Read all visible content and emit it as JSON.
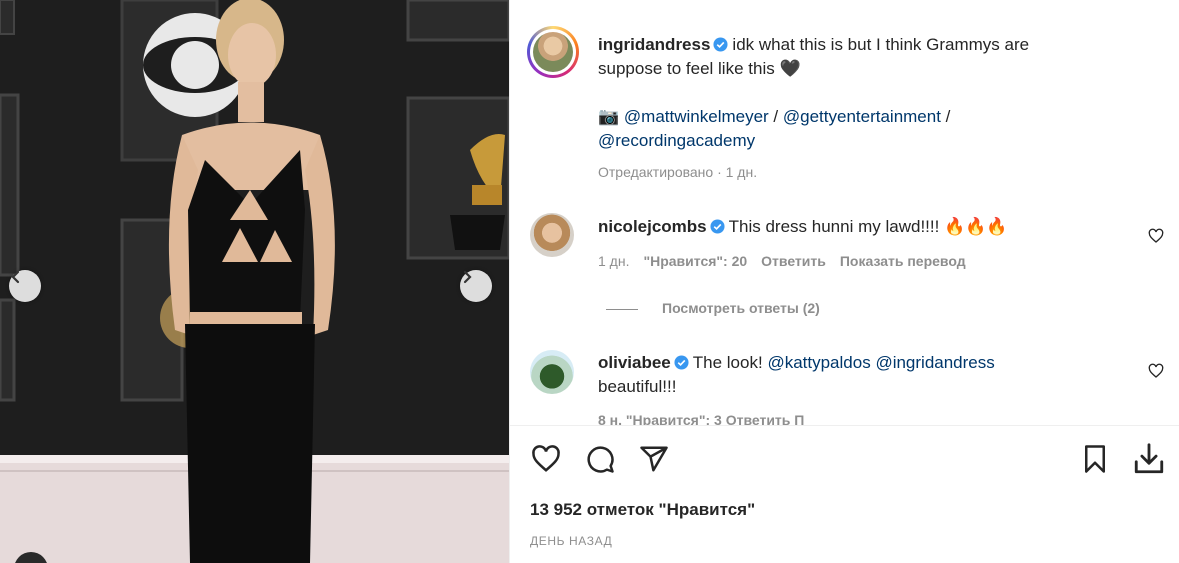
{
  "post": {
    "author": "ingridandress",
    "caption_line1": "idk what this is but I think Grammys are",
    "caption_line2": "suppose to feel like this 🖤",
    "camera_emoji": "📷",
    "credit1": "@mattwinkelmeyer",
    "sep1": " / ",
    "credit2": "@gettyentertainment",
    "sep2": " /",
    "credit3": "@recordingacademy",
    "edited": "Отредактировано · 1 дн."
  },
  "comments": [
    {
      "user": "nicolejcombs",
      "text": "This dress hunni my lawd!!!! 🔥🔥🔥",
      "time": "1 дн.",
      "likes": "\"Нравится\": 20",
      "reply": "Ответить",
      "translate": "Показать перевод",
      "view_replies": "Посмотреть ответы (2)"
    },
    {
      "user": "oliviabee",
      "text": "The look!",
      "mention1": "@kattypaldos",
      "mention2": "@ingridandress",
      "text2": "beautiful!!!",
      "meta_partial": "8 н.   \"Нравится\": 3   Ответить   П"
    }
  ],
  "stats": {
    "likes": "13 952 отметок \"Нравится\"",
    "time_ago": "ДЕНЬ НАЗАД"
  },
  "icons": {
    "verified": "verified-badge-icon",
    "like": "heart-icon",
    "comment": "comment-bubble-icon",
    "share": "paper-plane-icon",
    "save": "bookmark-icon",
    "download": "download-icon",
    "prev": "chevron-left-icon",
    "next": "chevron-right-icon"
  },
  "colors": {
    "verified": "#3897f0",
    "link": "#00376b",
    "muted": "#8e8e8e"
  }
}
